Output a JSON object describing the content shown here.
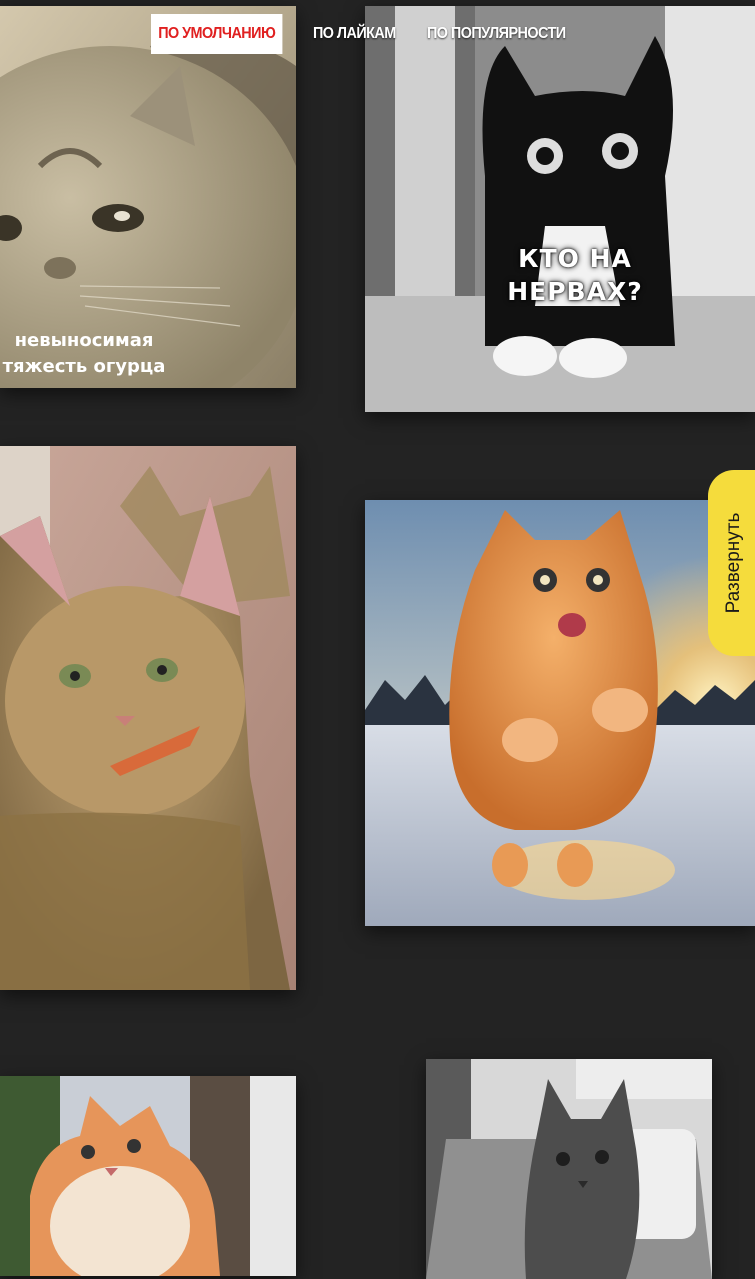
{
  "sort": {
    "default_label": "ПО УМОЛЧАНИЮ",
    "likes_label": "ПО ЛАЙКАМ",
    "popularity_label": "ПО ПОПУЛЯРНОСТИ",
    "active": "default"
  },
  "cards": [
    {
      "caption_line1": "невыносимая",
      "caption_line2": "тяжесть огурца",
      "tone": "sepia"
    },
    {
      "caption_line1": "КТО НА",
      "caption_line2": "НЕРВАХ?",
      "tone": "grayscale"
    },
    {
      "tone": "color"
    },
    {
      "tone": "color"
    },
    {
      "tone": "color"
    },
    {
      "tone": "grayscale"
    }
  ],
  "expand": {
    "label": "Развернуть",
    "color": "#f5dc3c"
  },
  "colors": {
    "background": "#232323",
    "active_sort_text": "#e02020",
    "active_sort_bg": "#ffffff"
  }
}
